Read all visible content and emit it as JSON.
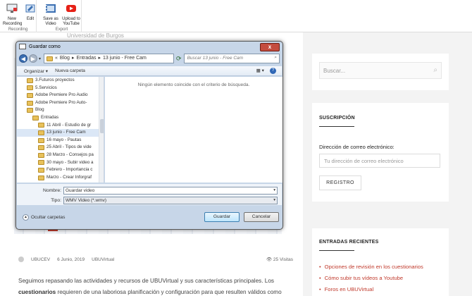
{
  "ribbon": {
    "groups": [
      {
        "label": "Recording",
        "buttons": [
          {
            "label1": "New",
            "label2": "Recording"
          },
          {
            "label1": "Edit",
            "label2": ""
          }
        ]
      },
      {
        "label": "Export",
        "buttons": [
          {
            "label1": "Save as",
            "label2": "Video"
          },
          {
            "label1": "Upload to",
            "label2": "YouTube"
          }
        ]
      }
    ]
  },
  "page": {
    "faded_title": "Universidad de Burgos",
    "meta": {
      "author": "UBUCEV",
      "date": "6 Junio, 2019",
      "category": "UBUVirtual",
      "views": "25 Visitas"
    },
    "body_line1": "Seguimos repasando las actividades y recursos de UBUVirtual y sus características principales. Los",
    "body_bold": "cuestionarios",
    "body_line2": " requieren de una laboriosa planificación y configuración para que resulten válidos como"
  },
  "sidebar": {
    "search_placeholder": "Buscar...",
    "subscription": {
      "title": "SUSCRIPCIÓN",
      "email_label": "Dirección de correo electrónico:",
      "email_placeholder": "Tu dirección de correo electrónico",
      "button": "REGISTRO"
    },
    "recent": {
      "title": "ENTRADAS RECIENTES",
      "items": [
        "Opciones de revisión en los cuestionarios",
        "Cómo subir tus vídeos a Youtube",
        "Foros en UBUVirtual"
      ]
    }
  },
  "dialog": {
    "title": "Guardar como",
    "close": "x",
    "address": {
      "prefix": "«",
      "parts": [
        "Blog",
        "Entradas",
        "13 junio - Free Cam"
      ]
    },
    "search_placeholder": "Buscar 13 junio - Free Cam",
    "toolbar": {
      "organize": "Organizar ▾",
      "new_folder": "Nueva carpeta",
      "view": "▦ ▾",
      "help": "?"
    },
    "tree": [
      {
        "label": "3.Futuros proyectos",
        "indent": 1,
        "selected": false
      },
      {
        "label": "5.Servicios",
        "indent": 1,
        "selected": false
      },
      {
        "label": "Adobe Premiere Pro Audio",
        "indent": 1,
        "selected": false
      },
      {
        "label": "Adobe Premiere Pro Auto-",
        "indent": 1,
        "selected": false
      },
      {
        "label": "Blog",
        "indent": 1,
        "selected": false
      },
      {
        "label": "Entradas",
        "indent": 2,
        "selected": false
      },
      {
        "label": "11 Abril - Estudio de gr",
        "indent": 3,
        "selected": false
      },
      {
        "label": "13 junio - Free Cam",
        "indent": 3,
        "selected": true
      },
      {
        "label": "16 mayo - Pautas",
        "indent": 3,
        "selected": false
      },
      {
        "label": "25 Abril - Tipos de vide",
        "indent": 3,
        "selected": false
      },
      {
        "label": "28 Marzo - Consejos pa",
        "indent": 3,
        "selected": false
      },
      {
        "label": "30 mayo - Subir video a",
        "indent": 3,
        "selected": false
      },
      {
        "label": "Febrero - Importancia c",
        "indent": 3,
        "selected": false
      },
      {
        "label": "Marzo - Crear Inforgraf",
        "indent": 3,
        "selected": false
      }
    ],
    "empty_message": "Ningún elemento coincide con el criterio de búsqueda.",
    "name_label": "Nombre:",
    "name_value": "Guardar video",
    "type_label": "Tipo:",
    "type_value": "WMV Video (*.wmv)",
    "hide_folders": "Ocultar carpetas",
    "save_button": "Guardar",
    "cancel_button": "Cancelar"
  }
}
